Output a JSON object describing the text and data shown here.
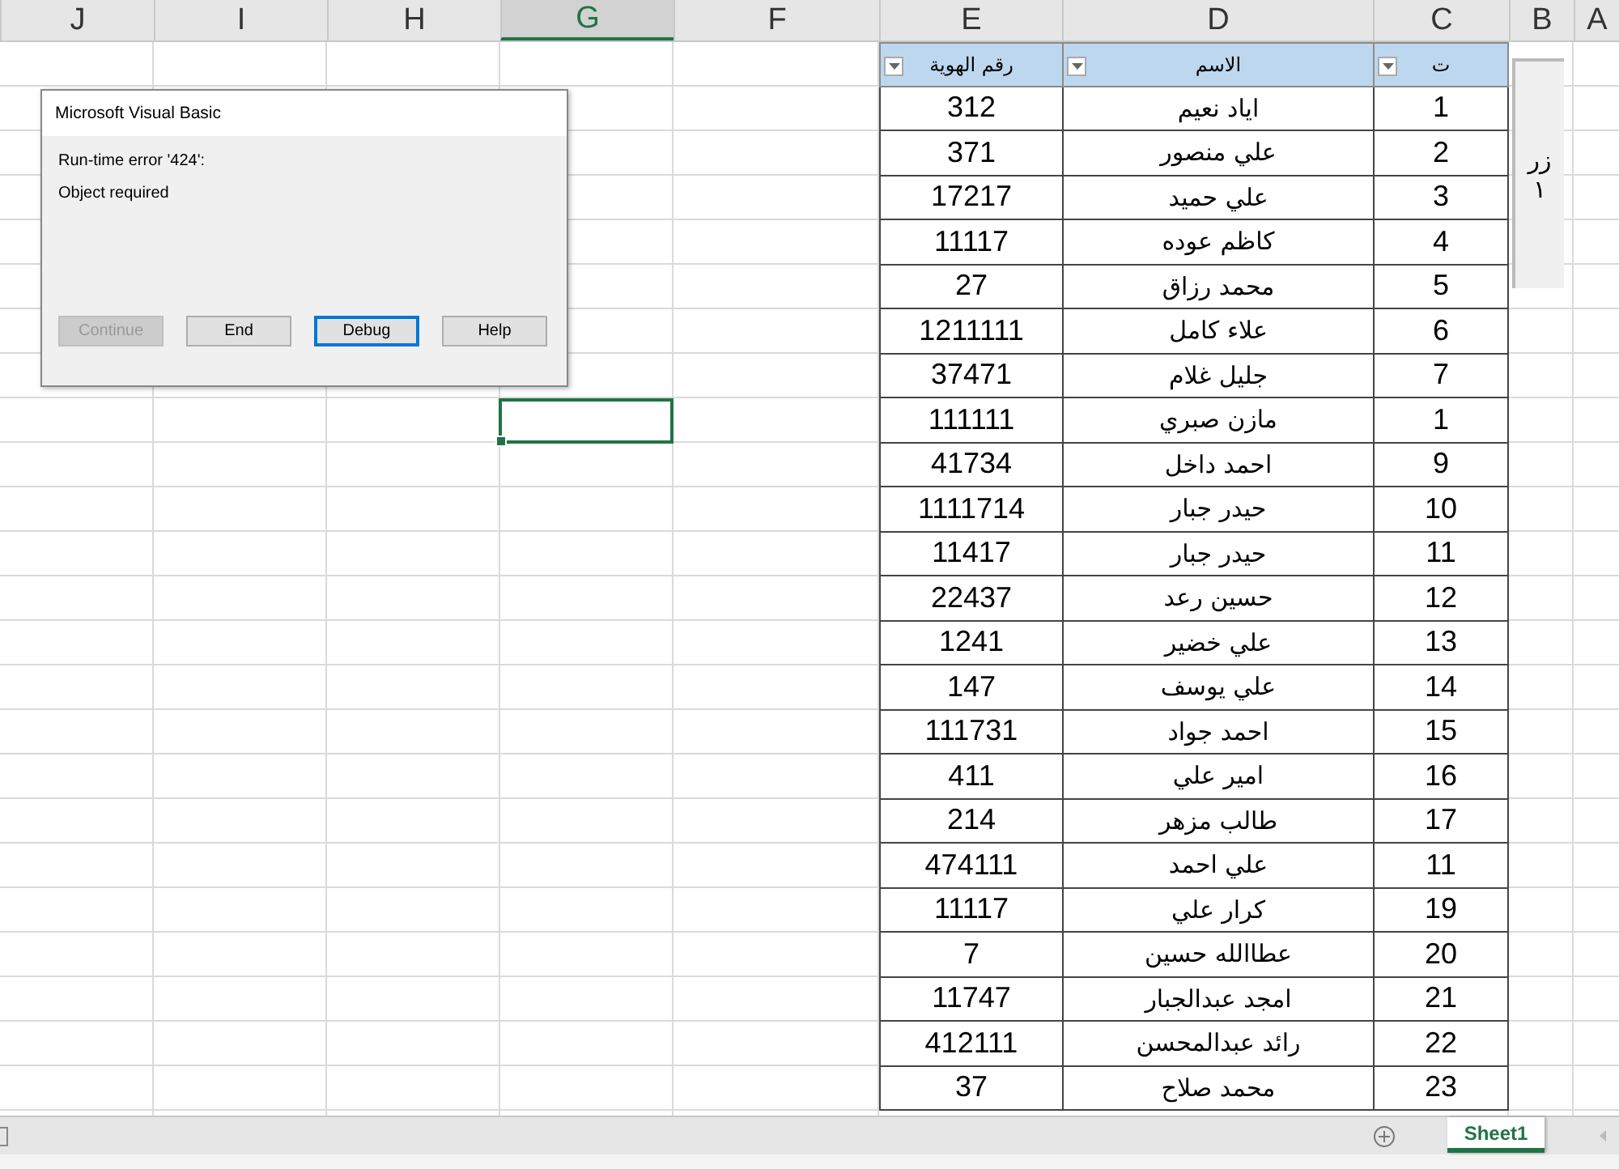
{
  "column_headers": [
    {
      "label": "A",
      "selected": false
    },
    {
      "label": "B",
      "selected": false
    },
    {
      "label": "C",
      "selected": false
    },
    {
      "label": "D",
      "selected": false
    },
    {
      "label": "E",
      "selected": false
    },
    {
      "label": "F",
      "selected": false
    },
    {
      "label": "G",
      "selected": true
    },
    {
      "label": "H",
      "selected": false
    },
    {
      "label": "I",
      "selected": false
    },
    {
      "label": "J",
      "selected": false
    }
  ],
  "table": {
    "columns": [
      "ت",
      "الاسم",
      "رقم الهوية"
    ],
    "rows": [
      {
        "cells": [
          "1",
          "اياد نعيم",
          "312"
        ],
        "active_cell": false
      },
      {
        "cells": [
          "2",
          "علي منصور",
          "371"
        ],
        "active_cell": false
      },
      {
        "cells": [
          "3",
          "علي حميد",
          "17217"
        ],
        "active_cell": false
      },
      {
        "cells": [
          "4",
          "كاظم عوده",
          "11117"
        ],
        "active_cell": false
      },
      {
        "cells": [
          "5",
          "محمد رزاق",
          "27"
        ],
        "active_cell": false
      },
      {
        "cells": [
          "6",
          "علاء كامل",
          "1211111"
        ],
        "active_cell": false
      },
      {
        "cells": [
          "7",
          "جليل غلام",
          "37471"
        ],
        "active_cell": false
      },
      {
        "cells": [
          "1",
          "مازن صبري",
          "111111"
        ],
        "active_cell": true
      },
      {
        "cells": [
          "9",
          "احمد داخل",
          "41734"
        ],
        "active_cell": false
      },
      {
        "cells": [
          "10",
          "حيدر جبار",
          "1111714"
        ],
        "active_cell": false
      },
      {
        "cells": [
          "11",
          "حيدر جبار",
          "11417"
        ],
        "active_cell": false
      },
      {
        "cells": [
          "12",
          "حسين رعد",
          "22437"
        ],
        "active_cell": false
      },
      {
        "cells": [
          "13",
          "علي خضير",
          "1241"
        ],
        "active_cell": false
      },
      {
        "cells": [
          "14",
          "علي يوسف",
          "147"
        ],
        "active_cell": false
      },
      {
        "cells": [
          "15",
          "احمد جواد",
          "111731"
        ],
        "active_cell": false
      },
      {
        "cells": [
          "16",
          "امير علي",
          "411"
        ],
        "active_cell": false
      },
      {
        "cells": [
          "17",
          "طالب مزهر",
          "214"
        ],
        "active_cell": false
      },
      {
        "cells": [
          "11",
          "علي احمد",
          "474111"
        ],
        "active_cell": false
      },
      {
        "cells": [
          "19",
          "كرار علي",
          "11117"
        ],
        "active_cell": false
      },
      {
        "cells": [
          "20",
          "عطاالله حسين",
          "7"
        ],
        "active_cell": false
      },
      {
        "cells": [
          "21",
          "امجد عبدالجبار",
          "11747"
        ],
        "active_cell": false
      },
      {
        "cells": [
          "22",
          "رائد عبدالمحسن",
          "412111"
        ],
        "active_cell": false
      },
      {
        "cells": [
          "23",
          "محمد صلاح",
          "37"
        ],
        "active_cell": false
      }
    ]
  },
  "form_button": {
    "label_lines": [
      "زر",
      "١"
    ]
  },
  "dialog": {
    "title": "Microsoft Visual Basic",
    "message_lines": [
      "Run-time error '424':",
      "Object required"
    ],
    "buttons": [
      {
        "label": "Help",
        "disabled": false,
        "focused": false
      },
      {
        "label": "Debug",
        "disabled": false,
        "focused": true
      },
      {
        "label": "End",
        "disabled": false,
        "focused": false
      },
      {
        "label": "Continue",
        "disabled": true,
        "focused": false
      }
    ]
  },
  "sheet_tabs": [
    {
      "label": "Sheet1",
      "selected": true
    }
  ]
}
